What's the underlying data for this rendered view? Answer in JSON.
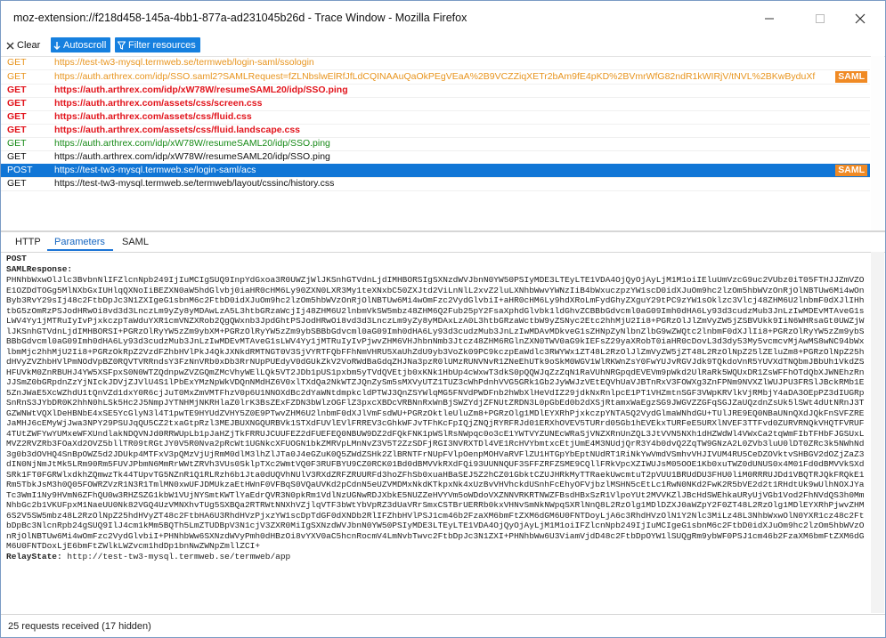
{
  "window": {
    "title": "moz-extension://f218d458-145a-4bb1-877a-ad231045b26d - Trace Window - Mozilla Firefox"
  },
  "toolbar": {
    "clear_label": "Clear",
    "autoscroll_label": "Autoscroll",
    "filter_label": "Filter resources"
  },
  "requests": [
    {
      "method": "GET",
      "url": "https://test-tw3-mysql.termweb.se/termweb/login-saml/ssologin",
      "color": "orange",
      "saml": ""
    },
    {
      "method": "GET",
      "url": "https://auth.arthrex.com/idp/SSO.saml2?SAMLRequest=fZLNbslwElRfJfLdCQINAAuQaOkPEgVEaA%2B9VCZZiqXETr2bAm9fE4pKD%2BVmrWfG82ndR1kWIRjV/tNVL%2BKwByduXf",
      "color": "orange",
      "saml": "SAML"
    },
    {
      "method": "GET",
      "url": "https://auth.arthrex.com/idp/xW78W/resumeSAML20/idp/SSO.ping",
      "color": "red",
      "saml": ""
    },
    {
      "method": "GET",
      "url": "https://auth.arthrex.com/assets/css/screen.css",
      "color": "red",
      "saml": ""
    },
    {
      "method": "GET",
      "url": "https://auth.arthrex.com/assets/css/fluid.css",
      "color": "red",
      "saml": ""
    },
    {
      "method": "GET",
      "url": "https://auth.arthrex.com/assets/css/fluid.landscape.css",
      "color": "red",
      "saml": ""
    },
    {
      "method": "GET",
      "url": "https://auth.arthrex.com/idp/xW78W/resumeSAML20/idp/SSO.ping",
      "color": "green",
      "saml": ""
    },
    {
      "method": "GET",
      "url": "https://auth.arthrex.com/idp/xW78W/resumeSAML20/idp/SSO.ping",
      "color": "black",
      "saml": ""
    },
    {
      "method": "POST",
      "url": "https://test-tw3-mysql.termweb.se/login-saml/acs",
      "color": "selected",
      "saml": "SAML"
    },
    {
      "method": "GET",
      "url": "https://test-tw3-mysql.termweb.se/termweb/layout/cssinc/history.css",
      "color": "black",
      "saml": ""
    }
  ],
  "tabs": {
    "http": "HTTP",
    "parameters": "Parameters",
    "saml": "SAML"
  },
  "details": {
    "method": "POST",
    "saml_response_label": "SAMLResponse:",
    "saml_response_value": "PHNhbWxwOlJlc3BvbnNlIFZlcnNpb249IjIuMCIgSUQ9InpYdGxoa3R0UWZjWlJKSnhGTVdnLjdIMHBORSIgSXNzdWVJbnN0YW50PSIyMDE3LTEyLTE1VDA4OjQyOjAyLjM1M1oiIEluUmVzcG9uc2VUbz0iT05FTHJJZmVZOE1OZDdTOGg5MlNXbGxIUHlqQXNoIiBEZXN0aW5hdGlvbj0iaHR0cHM6Ly90ZXN0LXR3My1teXNxbC50ZXJtd2ViLnNlL2xvZ2luLXNhbWwvYWNzIiB4bWxuczpzYW1scD0idXJuOm9hc2lzOm5hbWVzOnRjOlNBTUw6Mi4wOnByb3RvY29sIj48c2FtbDpJc3N1ZXIgeG1sbnM6c2FtbD0idXJuOm9hc2lzOm5hbWVzOnRjOlNBTUw6Mi4wOmFzc2VydGlvbiI+aHR0cHM6Ly9hdXRoLmFydGhyZXguY29tPC9zYW1sOklzc3Vlcj48ZHM6U2lnbmF0dXJlIHhtbG5zOmRzPSJodHRwOi8vd3d3LnczLm9yZy8yMDAwLzA5L3htbGRzaWcjIj48ZHM6U2lnbmVkSW5mbz48ZHM6Q2Fub25pY2FsaXphdGlvbk1ldGhvZCBBbGdvcml0aG09Imh0dHA6Ly93d3cudzMub3JnLzIwMDEvMTAveG1sLWV4Yy1jMTRuIyIvPjxkczpTaWduYXR1cmVNZXRob2QgQWxnb3JpdGhtPSJodHRwOi8vd3d3LnczLm9yZy8yMDAxLzA0L3htbGRzaWctbW9yZSNyc2Etc2hhMjU2Ii8+PGRzOlJlZmVyZW5jZSBVUkk9IiN6WHRsaGt0UWZjWlJKSnhGTVdnLjdIMHBORSI+PGRzOlRyYW5zZm9ybXM+PGRzOlRyYW5zZm9ybSBBbGdvcml0aG09Imh0dHA6Ly93d3cudzMub3JnLzIwMDAvMDkveG1sZHNpZyNlbnZlbG9wZWQtc2lnbmF0dXJlIi8+PGRzOlRyYW5zZm9ybSBBbGdvcml0aG09Imh0dHA6Ly93d3cudzMub3JnLzIwMDEvMTAveG1sLWV4Yy1jMTRuIyIvPjwvZHM6VHJhbnNmb3Jtcz48ZHM6RGlnZXN0TWV0aG9kIEFsZ29yaXRobT0iaHR0cDovL3d3dy53My5vcmcvMjAwMS8wNC94bWxlbmMjc2hhMjU2Ii8+PGRzOkRpZ2VzdFZhbHVlPkJ4QkJXNkdRMTNGT0V3SjVYRTFQbFFhNmVHRU5XaUhZdU9yb3VoZk09PC9kczpEaWdlc3RWYWx1ZT48L2RzOlJlZmVyZW5jZT48L2RzOlNpZ25lZEluZm8+PGRzOlNpZ25hdHVyZVZhbHVlPmNOdVpBZ0RQVTVRRndsY3FzNnVRb0xDb3RrNUpPUEdyV0dGUkZkV2VoRWdBaGdqZHJNa3pzR0lUMzRUNVNvR1ZNeEhUTk9oSkM0WGV1WlRKWnZsY0FwYUJvRGVJdk9TQkdoVnR5YUVXdTNQbmJBbUh1VkdZSHFUVkM0ZnRBUHJ4YW5XSFpxS0N0WTZQdnpwZVZGQmZMcVhyWElLQk5VT2JDb1pUS1pxbm5yTVdQVEtjb0xKNk1HbUp4cWxwT3dkS0pQQWJqZzZqN1RaVUhNRGpqdEVEVm9pWkd2UlRaRk5WQUxDR1ZsWFFhOTdQbXJWNEhzRnJJSmZ0bGRpdnZzYjNIckJDVjZJVlU4S1lPbExYMzNpWkVDQnNMdHZ6V0xlTXdQa2NkWTZJQnZySm5sMXVyUTZ1TUZ3cWhPdnhVVG5GRk1Gb2JyWWJzVEtEQVhUaVJBTnRxV3FOWXg3ZnFPNm9NVXZlWUJPU3FRSlJBckRMb1E5ZnJWaE5XcWZhdU1tQnVZd1dxY0R6cjJuT0MxZmVMTFhzV0p6U1NNOXdBc2dYaWNtdmpkcldPTWJ3QnZSYWlqMG5FNVdPWDFnb2hWbXlHeVdIZ29jdkNxRnlpcE1PT1VHZmtnSGF3VWpKRVlkVjRMbjY4aDA3OEpPZ3dIUGRpSnRnS3JYbDR0K2hhN0hLSk5Hc2J5NmpJYTNHMjNKRHlaZ0lrK3BsZExFZDN3bWlzOGFlZ3pxcXBDcVRBNnRxWnBjSWZYdjZFNUtZRDN3L0pGbEd0b2dXSjRtamxWaEgzSG9JWGVZZGFqSGJZaUQzdnZsUk5lSWt4dUtNRnJ3TGZWNWtVQXlDeHBNbE4xSE5YcGlyN3l4T1pwTE9HYUdZVHY5Z0E9PTwvZHM6U2lnbmF0dXJlVmFsdWU+PGRzOktleUluZm8+PGRzOlg1MDlEYXRhPjxkczpYNTA5Q2VydGlmaWNhdGU+TUlJRE9EQ0NBaUNnQXdJQkFnSVFZREJaMHJ6cEMyWjJwa3NPY29PSUJqQU5CZ2txaGtpRzl3MEJBUXNGQURBVk1STXdFUVlEVlFRREV3cGhkWFJvTFhKcFpIQjZNQjRYRFRJd01ERXhOVEV5TURrd05Gb1hEVEkxTURFeE5URXlNVEF3TTFvd0ZURVRNQkVHQTFVRUF4TUtZWFYwYUMxeWFXUndlakNDQVNJd0RRWUpLb1pJaHZjTkFRRUJCUUFEZ2dFUEFEQ0NBUW9DZ2dFQkFNK1pWSlRsNWpqc0o3cE1YWTVYZUNEcWRaSjVNZXRnUnZQL3JtVVN5NXh1dHZWdWl4VWxCa2tqWmFIbTFHbFJGSUxLMVZ2RVZRb3FOaXd2OVZ5bllTR09tRGtJY0V5R0Nva2pRcWt1UGNkcXFUOGN1bkZMRVpLMnNvZ3V5T2ZzSDFjRGI3NVRXTDl4VE1RcHVYbmtxcEtjUmE4M3NUdjQrR3Y4b0dvQ2ZqTW9GNzA2L0ZVb3luU0lDT0ZRc3k5NWhNd3g0b3dOVHQ4SnBpOWZ5d2JDUkp4MTFxV3pQMzVjUjRmM0dlM3lhZlJTa0J4eGZuK0Q5ZWdZSHk2ZlBRNTFrNUpFVlpOenpMOHVaRVFlZU1HTGpYbEptNUdRT1RiNkYwVmdVSmhvVHJIVUM4RU5CeDZOVktvSHBGV2dOZjZaZ3dIN0NjNmJtMk5LRm90Rm5FUVJPbmN6MmRrWWtZRVh3VUs0SklpTXc2WmtVQ0F3RUFBYU9CZ0RCK01Bd0dBMVVkRXdFQi93UUNNQUF3SFFZRFZSME9CQllFRkVpcXZIWUJsM05OOE1Kb0xuTWZ0dUNUS0x4M01Fd0dBMVVkSXdSRk1FT0FGRWlxdkhZQmwzTk44TUpvTG5NZnR1Q1RLRzh6b1Jta0dUQVhNUlV3RXdZRFZRUURFd3hoZFhSb0xuaHBaSEJ5Z2hCZ01GbktCZUJHRkMyTTRaekUwcmtuT2pVUU1BRUdDU3FHU0liM0RRRUJDd1VBQTRJQkFRQkE1Rm5TbkJsM3h0Q05FOWRZVzR1N3R1TmlMN0xwUFJDMUkzaEtHWnF0VFBqS0VQaUVKd2pCdnN5eUZVMDMxNkdKTkpxNk4xUzBvVHVhckdUSnhFcEhyOFVjbzlMSHN5cEtLc1RwN0NKd2FwK2R5bVE2d2t1RHdtUk9wUlhNOXJYaTc3WmI1Ny9HVmN6ZFhQU0w3RHZSZG1kbW1VUjNYSmtKWTlYaEdrQVR3N0pkRm1VdlNzUGNwRDJXbkE5NUZZeHVYVm5oWDdoVXZNNVRKRTNWZFBsdHBxSzR1VlpoYUt2MVVKZlJBcHdSWEhkaURyUjVGb1Vod2FhNVdQS3h0MmNhbGc2b1VKUFpxM1NaeUU0Nk82VGQ4UzVMNXhvTUg5SXBQa2RTRWtNNXhVZjlqVTF3bWtYbVpRZ3dUaVRrSmxCSTBrUERRb0kxVHNvSmNkNWpqSXRlNnQ8L2RzOlg1MDlDZXJ0aWZpY2F0ZT48L2RzOlg1MDlEYXRhPjwvZHM6S2V5SW5mbz48L2RzOlNpZ25hdHVyZT48c2FtbHA6U3RhdHVzPjxzYW1scDpTdGF0dXNDb2RlIFZhbHVlPSJ1cm46b2FzaXM6bmFtZXM6dGM6U0FNTDoyLjA6c3RhdHVzOlN1Y2Nlc3MiLz48L3NhbWxwOlN0YXR1cz48c2FtbDpBc3NlcnRpb24gSUQ9IlJ4cm1kMm5BQTh5LmZTUDBpV3N1cjV3ZXR0MiIgSXNzdWVJbnN0YW50PSIyMDE3LTEyLTE1VDA4OjQyOjAyLjM1M1oiIFZlcnNpb249IjIuMCIgeG1sbnM6c2FtbD0idXJuOm9hc2lzOm5hbWVzOnRjOlNBTUw6Mi4wOmFzc2VydGlvbiI+PHNhbWw6SXNzdWVyPmh0dHBzOi8vYXV0aC5hcnRocmV4LmNvbTwvc2FtbDpJc3N1ZXI+PHNhbWw6U3ViamVjdD48c2FtbDpOYW1lSUQgRm9ybWF0PSJ1cm46b2FzaXM6bmFtZXM6dGM6U0FNTDoxLjE6bmFtZWlkLWZvcm1hdDp1bnNwZWNpZmllZCI+",
    "relay_state_label": "RelayState:",
    "relay_state_value": "http://test-tw3-mysql.termweb.se/termweb/app"
  },
  "status": {
    "text": "25 requests received (17 hidden)"
  }
}
